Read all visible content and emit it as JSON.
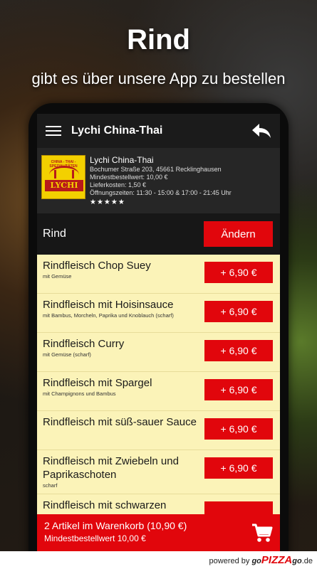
{
  "promo": {
    "title": "Rind",
    "subtitle": "gibt es über unsere App zu bestellen"
  },
  "appbar": {
    "title": "Lychi China-Thai",
    "menu_icon": "hamburger-icon",
    "back_icon": "back-arrow-icon"
  },
  "restaurant": {
    "logo_top": "CHINA - THAI - SPEZIALITÄTEN",
    "logo_text": "LYCHI",
    "name": "Lychi China-Thai",
    "address": "Bochumer Straße 203, 45661 Recklinghausen",
    "min_order": "Mindestbestellwert: 10,00 €",
    "delivery": "Lieferkosten: 1,50 €",
    "hours": "Öffnungszeiten: 11:30 - 15:00 & 17:00 - 21:45 Uhr",
    "rating": "★★★★★"
  },
  "category": {
    "label": "Rind",
    "change_label": "Ändern"
  },
  "items": [
    {
      "name": "Rindfleisch Chop Suey",
      "desc": "mit Gemüse",
      "price": "+ 6,90 €"
    },
    {
      "name": "Rindfleisch mit Hoisinsauce",
      "desc": "mit Bambus, Morcheln, Paprika und Knoblauch (scharf)",
      "price": "+ 6,90 €"
    },
    {
      "name": "Rindfleisch Curry",
      "desc": "mit Gemüse (scharf)",
      "price": "+ 6,90 €"
    },
    {
      "name": "Rindfleisch mit Spargel",
      "desc": "mit Champignons und Bambus",
      "price": "+ 6,90 €"
    },
    {
      "name": "Rindfleisch mit süß-sauer Sauce",
      "desc": "",
      "price": "+ 6,90 €"
    },
    {
      "name": "Rindfleisch mit Zwiebeln und Paprikaschoten",
      "desc": "scharf",
      "price": "+ 6,90 €"
    },
    {
      "name": "Rindfleisch mit schwarzen",
      "desc": "",
      "price": ""
    }
  ],
  "cart": {
    "summary": "2 Artikel im Warenkorb (10,90 €)",
    "min_order": "Mindestbestellwert 10,00 €",
    "icon": "cart-icon"
  },
  "footer": {
    "powered": "powered by",
    "brand_go": "go",
    "brand_pizza": "PIZZA",
    "brand_suffix": "go",
    "brand_tld": ".de"
  },
  "colors": {
    "accent": "#e1060c",
    "item_bg": "#fbf3b8",
    "appbar_bg": "#1b1b1b"
  }
}
